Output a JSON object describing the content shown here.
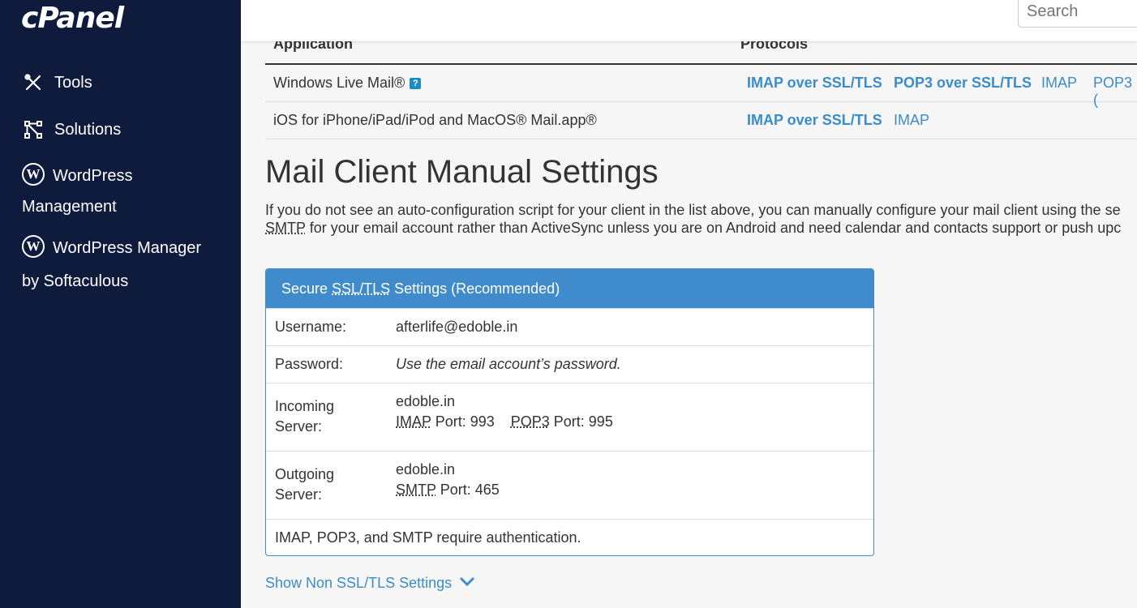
{
  "sidebar": {
    "logo": "cPanel",
    "items": [
      {
        "label": "Tools",
        "icon": "tools-icon"
      },
      {
        "label": "Solutions",
        "icon": "solutions-icon"
      },
      {
        "label_line1": "WordPress",
        "label_line2": "Management",
        "icon": "wordpress-icon"
      },
      {
        "label_line1": "WordPress Manager",
        "label_line2": "by Softaculous",
        "icon": "wordpress-icon"
      }
    ]
  },
  "header": {
    "search_placeholder": "Search"
  },
  "table": {
    "columns": [
      "Application",
      "Protocols"
    ],
    "rows": [
      {
        "app": "Windows Live Mail®",
        "protocols": [
          "IMAP over SSL/TLS",
          "POP3 over SSL/TLS",
          "IMAP",
          "POP3 ("
        ]
      },
      {
        "app": "iOS for iPhone/iPad/iPod and MacOS® Mail.app®",
        "protocols": [
          "IMAP over SSL/TLS",
          "IMAP"
        ]
      }
    ]
  },
  "manual": {
    "title": "Mail Client Manual Settings",
    "intro_line1": "If you do not see an auto-configuration script for your client in the list above, you can manually configure your mail client using the se",
    "intro_smtp": "SMTP",
    "intro_line2_rest": " for your email account rather than ActiveSync unless you are on Android and need calendar and contacts support or push upc"
  },
  "panel": {
    "heading_pre": "Secure ",
    "heading_abbr": "SSL/TLS",
    "heading_post": " Settings (Recommended)",
    "username_label": "Username:",
    "username_value": "afterlife@edoble.in",
    "password_label": "Password:",
    "password_value": "Use the email account’s password.",
    "incoming_label_1": "Incoming",
    "incoming_label_2": "Server:",
    "incoming_host": "edoble.in",
    "imap_abbr": "IMAP",
    "imap_port": " Port: 993",
    "pop3_abbr": "POP3",
    "pop3_port": " Port: 995",
    "outgoing_label_1": "Outgoing",
    "outgoing_label_2": "Server:",
    "outgoing_host": "edoble.in",
    "smtp_abbr": "SMTP",
    "smtp_port": " Port: 465",
    "auth_note": "IMAP, POP3, and SMTP require authentication."
  },
  "show_non_ssl": "Show Non SSL/TLS Settings",
  "colors": {
    "sidebar_bg": "#0f1b3d",
    "accent": "#3b8ccc"
  }
}
